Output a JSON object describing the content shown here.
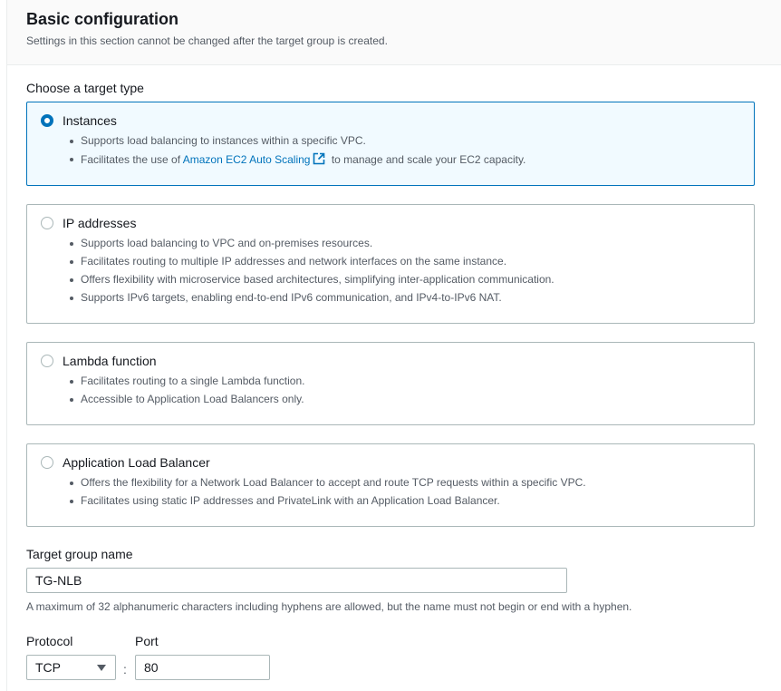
{
  "header": {
    "title": "Basic configuration",
    "description": "Settings in this section cannot be changed after the target group is created."
  },
  "target_type": {
    "label": "Choose a target type",
    "options": [
      {
        "title": "Instances",
        "selected": true,
        "bullets": [
          "Supports load balancing to instances within a specific VPC.",
          {
            "before": "Facilitates the use of ",
            "link": "Amazon EC2 Auto Scaling",
            "after": " to manage and scale your EC2 capacity."
          }
        ]
      },
      {
        "title": "IP addresses",
        "selected": false,
        "bullets": [
          "Supports load balancing to VPC and on-premises resources.",
          "Facilitates routing to multiple IP addresses and network interfaces on the same instance.",
          "Offers flexibility with microservice based architectures, simplifying inter-application communication.",
          "Supports IPv6 targets, enabling end-to-end IPv6 communication, and IPv4-to-IPv6 NAT."
        ]
      },
      {
        "title": "Lambda function",
        "selected": false,
        "bullets": [
          "Facilitates routing to a single Lambda function.",
          "Accessible to Application Load Balancers only."
        ]
      },
      {
        "title": "Application Load Balancer",
        "selected": false,
        "bullets": [
          "Offers the flexibility for a Network Load Balancer to accept and route TCP requests within a specific VPC.",
          "Facilitates using static IP addresses and PrivateLink with an Application Load Balancer."
        ]
      }
    ]
  },
  "target_group_name": {
    "label": "Target group name",
    "value": "TG-NLB",
    "hint": "A maximum of 32 alphanumeric characters including hyphens are allowed, but the name must not begin or end with a hyphen."
  },
  "protocol": {
    "label": "Protocol",
    "value": "TCP"
  },
  "port": {
    "label": "Port",
    "value": "80",
    "separator": ":"
  },
  "icons": {
    "external_link": "external-link-icon",
    "dropdown": "caret-down-icon"
  },
  "colors": {
    "accent": "#0073bb",
    "selected_bg": "#f1faff",
    "border": "#aab7b8"
  }
}
